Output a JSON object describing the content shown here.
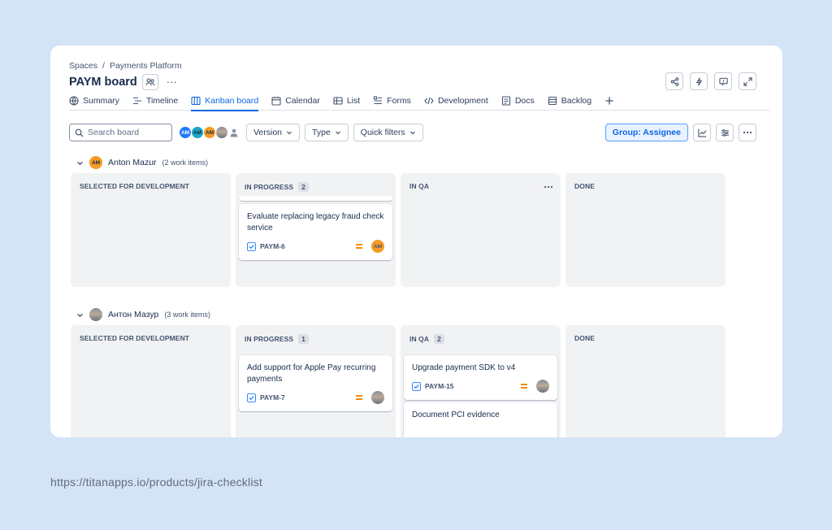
{
  "breadcrumb": {
    "root": "Spaces",
    "separator": "/",
    "project": "Payments Platform"
  },
  "board": {
    "title": "PAYM board",
    "more": "···"
  },
  "top_actions": [
    "share-icon",
    "automation-icon",
    "feedback-icon",
    "fullscreen-icon"
  ],
  "tabs": [
    {
      "label": "Summary",
      "icon": "globe-icon"
    },
    {
      "label": "Timeline",
      "icon": "timeline-icon"
    },
    {
      "label": "Kanban board",
      "icon": "board-icon",
      "active": true
    },
    {
      "label": "Calendar",
      "icon": "calendar-icon"
    },
    {
      "label": "List",
      "icon": "list-icon"
    },
    {
      "label": "Forms",
      "icon": "forms-icon"
    },
    {
      "label": "Development",
      "icon": "code-icon"
    },
    {
      "label": "Docs",
      "icon": "docs-icon"
    },
    {
      "label": "Backlog",
      "icon": "backlog-icon"
    }
  ],
  "toolbar": {
    "search_placeholder": "Search board",
    "avatars": [
      "AM",
      "AM",
      "AM"
    ],
    "version": "Version",
    "type": "Type",
    "quick_filters": "Quick filters",
    "group": "Group: Assignee"
  },
  "colors": {
    "accent": "#0c66e4",
    "avatar_blue": "#1d7afc",
    "avatar_teal": "#1ea7c5",
    "avatar_orange": "#f59b27",
    "priority": "#f18d13"
  },
  "columns": [
    "SELECTED FOR DEVELOPMENT",
    "IN PROGRESS",
    "IN QA",
    "DONE"
  ],
  "swimlanes": [
    {
      "name": "Anton Mazur",
      "avatar": "AM",
      "count": "(2 work items)",
      "in_progress_count": "2",
      "cards": [
        {
          "title": "Evaluate replacing legacy fraud check service",
          "key": "PAYM-6",
          "assignee": "AM"
        }
      ]
    },
    {
      "name": "Антон Мазур",
      "count": "(3 work items)",
      "in_progress_count": "1",
      "in_qa_count": "2",
      "cards": [
        {
          "title": "Add support for Apple Pay recurring payments",
          "key": "PAYM-7"
        },
        {
          "title": "Upgrade payment SDK to v4",
          "key": "PAYM-15"
        },
        {
          "title": "Document PCI evidence"
        }
      ]
    }
  ],
  "footer_url": "https://titanapps.io/products/jira-checklist"
}
